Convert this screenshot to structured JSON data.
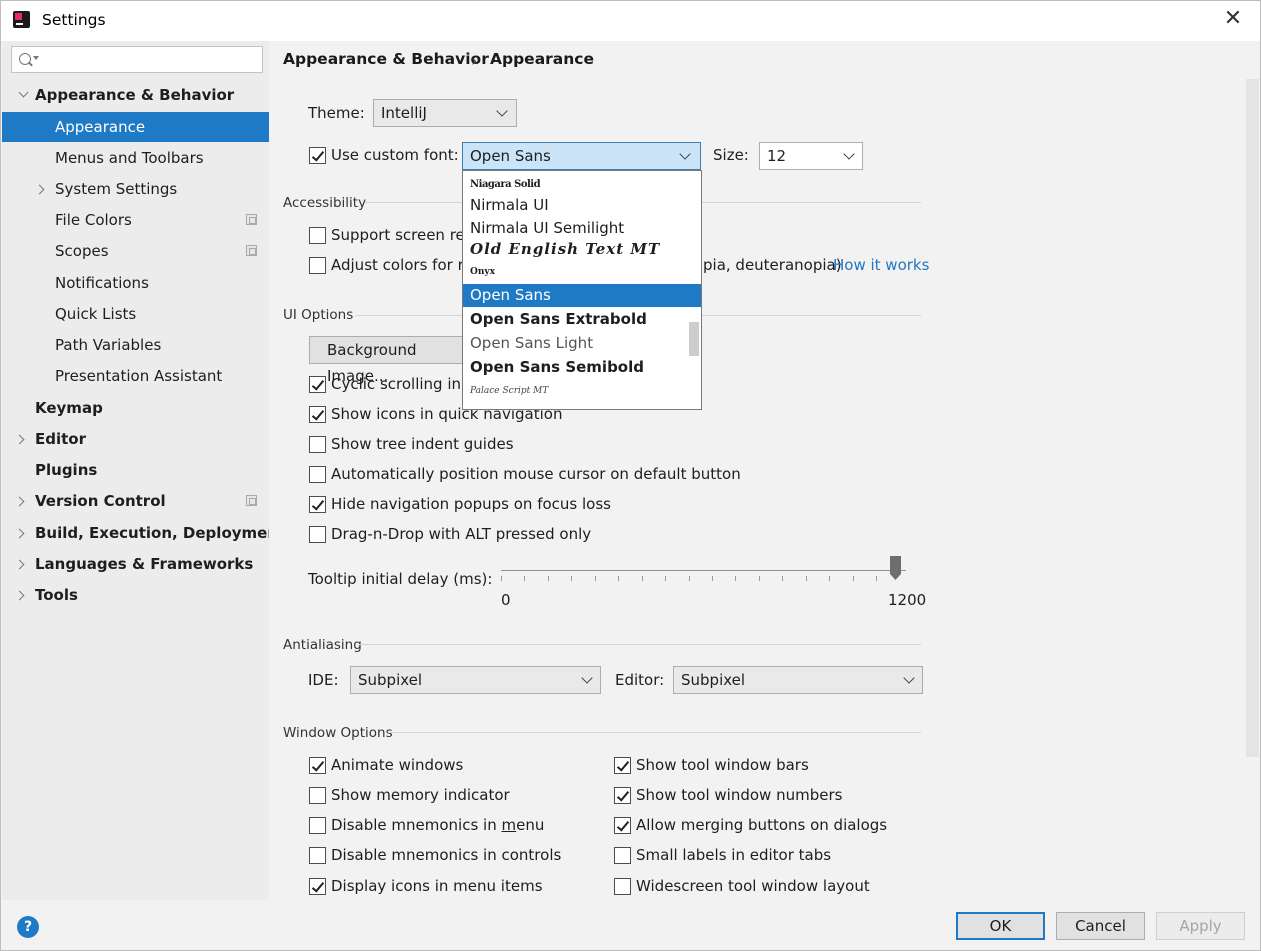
{
  "window": {
    "title": "Settings",
    "close_glyph": "✕"
  },
  "sidebar": {
    "search_placeholder": "",
    "items": [
      {
        "label": "Appearance & Behavior"
      },
      {
        "label": "Appearance"
      },
      {
        "label": "Menus and Toolbars"
      },
      {
        "label": "System Settings"
      },
      {
        "label": "File Colors"
      },
      {
        "label": "Scopes"
      },
      {
        "label": "Notifications"
      },
      {
        "label": "Quick Lists"
      },
      {
        "label": "Path Variables"
      },
      {
        "label": "Presentation Assistant"
      },
      {
        "label": "Keymap"
      },
      {
        "label": "Editor"
      },
      {
        "label": "Plugins"
      },
      {
        "label": "Version Control"
      },
      {
        "label": "Build, Execution, Deployment"
      },
      {
        "label": "Languages & Frameworks"
      },
      {
        "label": "Tools"
      }
    ]
  },
  "breadcrumb": {
    "parent": "Appearance & Behavior",
    "separator": "›",
    "current": "Appearance"
  },
  "theme": {
    "label": "Theme:",
    "value": "IntelliJ"
  },
  "font": {
    "checkbox_label": "Use custom font:",
    "value": "Open Sans",
    "size_label": "Size:",
    "size_value": "12"
  },
  "font_dropdown": {
    "items": [
      "Niagara Solid",
      "Nirmala UI",
      "Nirmala UI Semilight",
      "Old English Text MT",
      "Onyx",
      "Open Sans",
      "Open Sans Extrabold",
      "Open Sans Light",
      "Open Sans Semibold",
      "Palace Script MT"
    ],
    "selected": "Open Sans"
  },
  "accessibility": {
    "title": "Accessibility",
    "screen_reader_label": "Support screen rea",
    "adjust_colors_label": "Adjust colors for re",
    "adjust_colors_tail": "pia, deuteranopia)",
    "how_it_works": "How it works"
  },
  "ui_options": {
    "title": "UI Options",
    "background_image_button": "Background Image...",
    "cyclic_scrolling": "Cyclic scrolling in li",
    "show_icons_quick_nav": "Show icons in quick navigation",
    "show_tree_indent": "Show tree indent guides",
    "auto_position_cursor": "Automatically position mouse cursor on default button",
    "hide_nav_popups": "Hide navigation popups on focus loss",
    "drag_n_drop": "Drag-n-Drop with ALT pressed only",
    "tooltip_label": "Tooltip initial delay (ms):",
    "tooltip_min": "0",
    "tooltip_max": "1200",
    "tooltip_value_fraction": 1.0
  },
  "antialiasing": {
    "title": "Antialiasing",
    "ide_label": "IDE:",
    "ide_value": "Subpixel",
    "editor_label": "Editor:",
    "editor_value": "Subpixel"
  },
  "window_options": {
    "title": "Window Options",
    "animate_windows": "Animate windows",
    "show_memory": "Show memory indicator",
    "disable_mnemonics_menu_pre": "Disable mnemonics in ",
    "disable_mnemonics_menu_u": "m",
    "disable_mnemonics_menu_post": "enu",
    "disable_mnemonics_controls": "Disable mnemonics in controls",
    "display_icons_menu": "Display icons in menu items",
    "show_tool_window_bars": "Show tool window bars",
    "show_tool_window_numbers": "Show tool window numbers",
    "allow_merging_buttons": "Allow merging buttons on dialogs",
    "small_labels": "Small labels in editor tabs",
    "widescreen_layout": "Widescreen tool window layout"
  },
  "footer": {
    "help": "?",
    "ok": "OK",
    "cancel": "Cancel",
    "apply": "Apply"
  },
  "colors": {
    "accent": "#1f7ac6",
    "link": "#2476c2",
    "selection_focus": "#cce4f7"
  }
}
